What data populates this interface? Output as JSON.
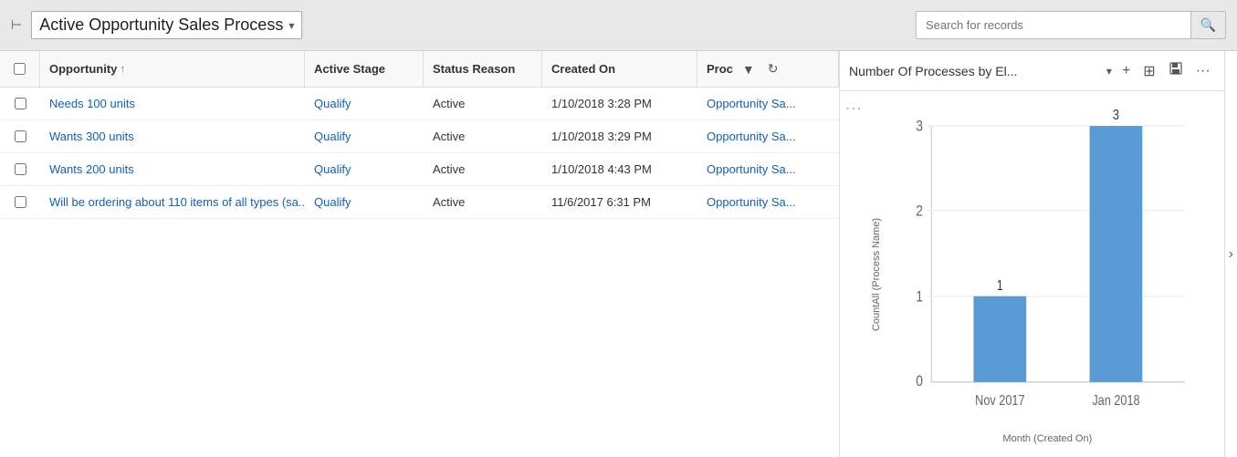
{
  "header": {
    "icon": "⊢",
    "title": "Active Opportunity Sales Process",
    "chevron": "▾",
    "search_placeholder": "Search for records",
    "search_icon": "🔍"
  },
  "table": {
    "columns": [
      {
        "id": "opportunity",
        "label": "Opportunity",
        "sort": "↑"
      },
      {
        "id": "active_stage",
        "label": "Active Stage"
      },
      {
        "id": "status_reason",
        "label": "Status Reason"
      },
      {
        "id": "created_on",
        "label": "Created On"
      },
      {
        "id": "process",
        "label": "Proc"
      }
    ],
    "rows": [
      {
        "opportunity": "Needs 100 units",
        "active_stage": "Qualify",
        "status_reason": "Active",
        "created_on": "1/10/2018 3:28 PM",
        "process": "Opportunity Sa..."
      },
      {
        "opportunity": "Wants 300 units",
        "active_stage": "Qualify",
        "status_reason": "Active",
        "created_on": "1/10/2018 3:29 PM",
        "process": "Opportunity Sa..."
      },
      {
        "opportunity": "Wants 200 units",
        "active_stage": "Qualify",
        "status_reason": "Active",
        "created_on": "1/10/2018 4:43 PM",
        "process": "Opportunity Sa..."
      },
      {
        "opportunity": "Will be ordering about 110 items of all types (sa...",
        "active_stage": "Qualify",
        "status_reason": "Active",
        "created_on": "11/6/2017 6:31 PM",
        "process": "Opportunity Sa..."
      }
    ]
  },
  "chart": {
    "title": "Number Of Processes by El...",
    "chevron": "▾",
    "y_axis_label": "CountAll (Process Name)",
    "x_axis_label": "Month (Created On)",
    "toolbar": {
      "add": "+",
      "expand": "⊞",
      "save": "💾",
      "more": "···"
    },
    "bars": [
      {
        "label": "Nov 2017",
        "value": 1,
        "color": "#5b9bd5"
      },
      {
        "label": "Jan 2018",
        "value": 3,
        "color": "#5b9bd5"
      }
    ],
    "y_max": 3,
    "y_ticks": [
      0,
      1,
      2,
      3
    ]
  }
}
